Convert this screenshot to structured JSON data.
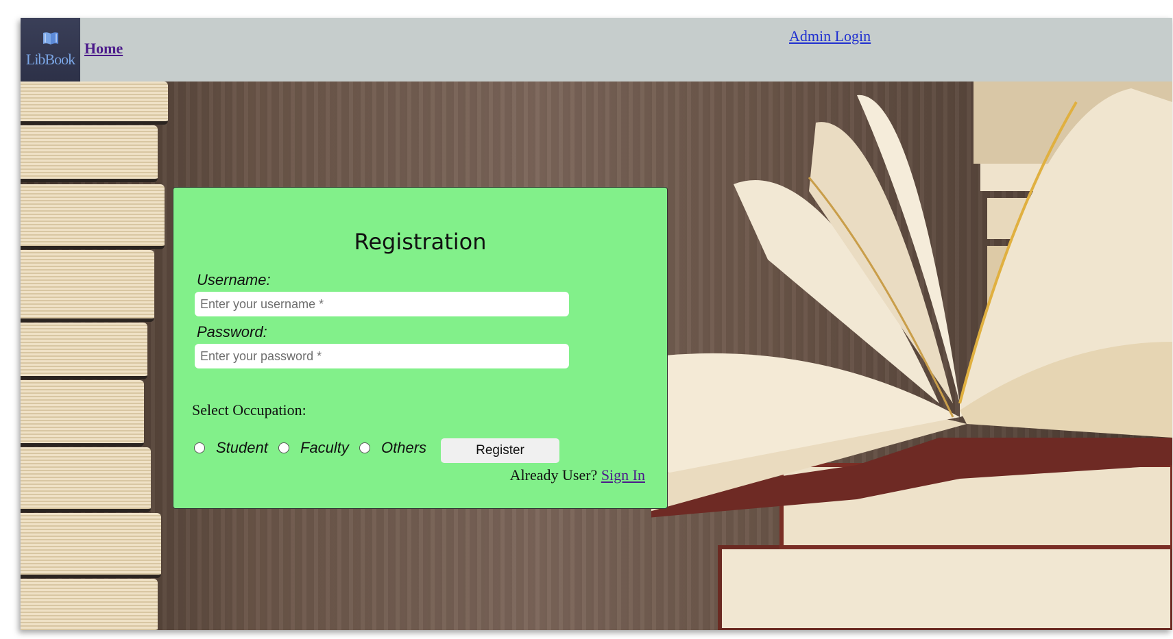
{
  "header": {
    "logo_text": "LibBook",
    "home_link": "Home",
    "admin_link": "Admin Login"
  },
  "form": {
    "title": "Registration",
    "username_label": "Username:",
    "username_placeholder": "Enter your username *",
    "password_label": "Password:",
    "password_placeholder": "Enter your password *",
    "occupation_label": "Select Occupation:",
    "occupations": [
      "Student",
      "Faculty",
      "Others"
    ],
    "register_button": "Register",
    "already_user_text": "Already User?",
    "sign_in_link": "Sign In"
  },
  "colors": {
    "card_bg": "#82f08a",
    "header_bg": "#c6cdcc",
    "link_visited": "#4b1a8a",
    "link": "#1f2fd0"
  },
  "icons": [
    "book-logo-icon"
  ]
}
